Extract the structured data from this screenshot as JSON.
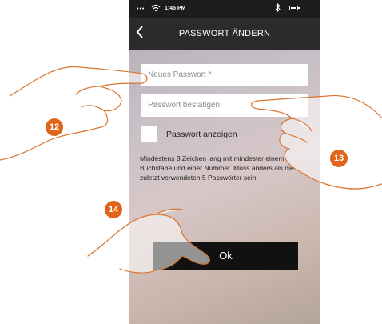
{
  "status_bar": {
    "dots": "•••",
    "time": "1:45 PM"
  },
  "header": {
    "title": "PASSWORT ÄNDERN",
    "back_icon": "chevron-left-icon"
  },
  "form": {
    "new_password_placeholder": "Neues Passwort *",
    "confirm_password_placeholder": "Passwort bestätigen",
    "show_password_label": "Passwort anzeigen",
    "show_password_checked": false,
    "hint": "Mindestens 8 Zeichen lang mit mindester einem Buchstabe und einer Nummer. Muss anders als die zuletzt verwendeten 5 Passwörter sein.",
    "ok_label": "Ok"
  },
  "callouts": [
    "12",
    "13",
    "14"
  ],
  "colors": {
    "accent": "#e06419",
    "navbar": "#2b2b2b",
    "button": "#111111"
  }
}
